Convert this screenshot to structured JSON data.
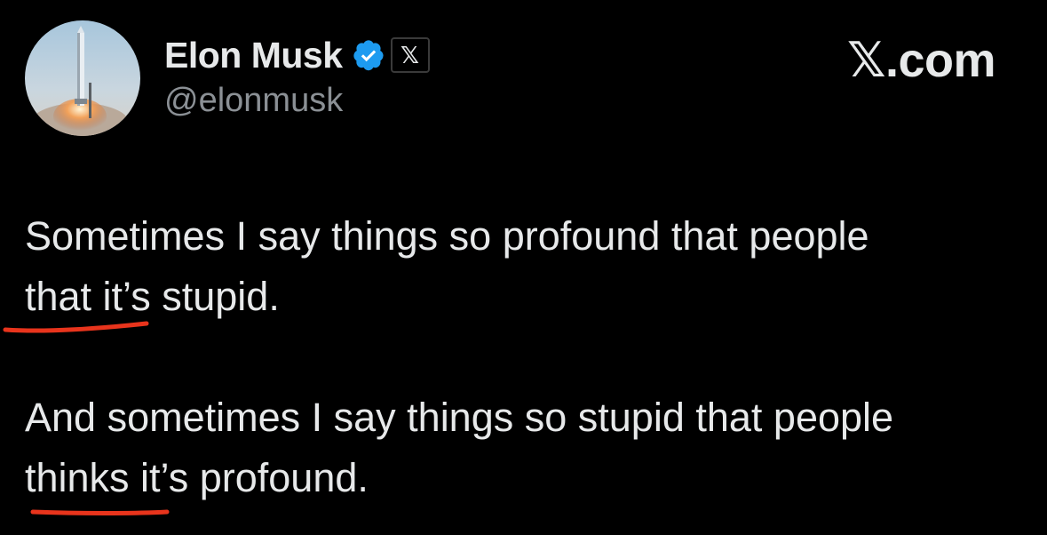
{
  "author": {
    "display_name": "Elon Musk",
    "handle": "@elonmusk",
    "verified_badge_color": "#1d9bf0",
    "affiliate_badge_glyph": "𝕏"
  },
  "brand": {
    "label": "𝕏.com"
  },
  "tweet": {
    "paragraphs": [
      {
        "lines": [
          "Sometimes I say things so profound that people",
          "that it’s stupid."
        ]
      },
      {
        "lines": [
          "And sometimes I say things so stupid that people",
          "thinks it’s profound."
        ]
      }
    ]
  },
  "annotations": {
    "underline_color": "#e8341c"
  }
}
